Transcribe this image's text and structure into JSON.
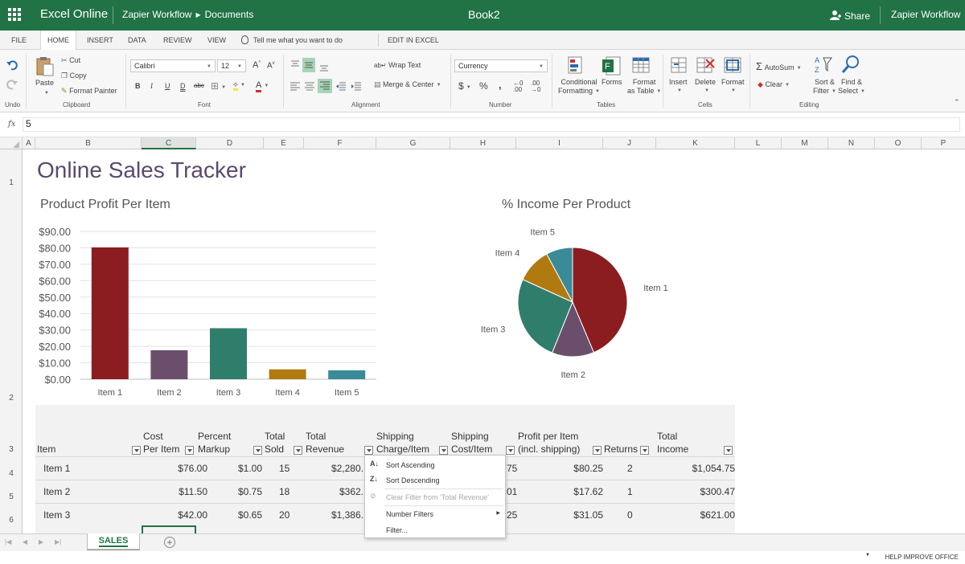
{
  "topbar": {
    "app_name": "Excel Online",
    "crumb_workspace": "Zapier Workflow",
    "crumb_folder": "Documents",
    "doc_title": "Book2",
    "share_label": "Share",
    "user_label": "Zapier Workflow"
  },
  "tabs": [
    "FILE",
    "HOME",
    "INSERT",
    "DATA",
    "REVIEW",
    "VIEW"
  ],
  "tell_me": "Tell me what you want to do",
  "edit_in_excel": "EDIT IN EXCEL",
  "ribbon": {
    "undo_label": "Undo",
    "clipboard": {
      "paste": "Paste",
      "cut": "Cut",
      "copy": "Copy",
      "format_painter": "Format Painter",
      "group": "Clipboard"
    },
    "font": {
      "name": "Calibri",
      "size": "12",
      "group": "Font"
    },
    "alignment": {
      "wrap": "Wrap Text",
      "merge": "Merge & Center",
      "group": "Alignment"
    },
    "number": {
      "format": "Currency",
      "currency_symbol": "$",
      "percent": "%",
      "comma": ",",
      "group": "Number"
    },
    "tables": {
      "cond1": "Conditional",
      "cond2": "Formatting",
      "forms": "Forms",
      "fmt1": "Format",
      "fmt2": "as Table",
      "group": "Tables"
    },
    "cells": {
      "insert": "Insert",
      "delete": "Delete",
      "format": "Format",
      "group": "Cells"
    },
    "editing": {
      "autosum": "AutoSum",
      "clear": "Clear",
      "sort1": "Sort &",
      "sort2": "Filter",
      "find1": "Find &",
      "find2": "Select",
      "group": "Editing"
    }
  },
  "formula_bar": {
    "fx": "fx",
    "value": "5"
  },
  "columns": [
    "A",
    "B",
    "C",
    "D",
    "E",
    "F",
    "G",
    "H",
    "I",
    "J",
    "K",
    "L",
    "M",
    "N",
    "O",
    "P"
  ],
  "rows": [
    "1",
    "2",
    "3",
    "4",
    "5",
    "6"
  ],
  "sheet_title": "Online Sales Tracker",
  "chart_data": [
    {
      "type": "bar",
      "title": "Product Profit Per Item",
      "categories": [
        "Item 1",
        "Item 2",
        "Item 3",
        "Item 4",
        "Item 5"
      ],
      "values": [
        80.25,
        17.62,
        31.05,
        6.0,
        5.4
      ],
      "colors": [
        "#8b1c1f",
        "#6b4e6c",
        "#2f7d6b",
        "#b07a10",
        "#3a8a97"
      ],
      "ylim": [
        0,
        90
      ],
      "yticks": [
        "$0.00",
        "$10.00",
        "$20.00",
        "$30.00",
        "$40.00",
        "$50.00",
        "$60.00",
        "$70.00",
        "$80.00",
        "$90.00"
      ],
      "grid": true
    },
    {
      "type": "pie",
      "title": "% Income Per Product",
      "categories": [
        "Item 1",
        "Item 2",
        "Item 3",
        "Item 4",
        "Item 5"
      ],
      "values": [
        1054.75,
        300.47,
        621.0,
        250.0,
        190.0
      ],
      "colors": [
        "#8b1c1f",
        "#6b4e6c",
        "#2f7d6b",
        "#b07a10",
        "#3a8a97"
      ]
    }
  ],
  "table": {
    "headers": {
      "item": "Item",
      "cost1": "Cost",
      "cost2": "Per Item",
      "pct1": "Percent",
      "pct2": "Markup",
      "sold1": "Total",
      "sold2": "Sold",
      "rev1": "Total",
      "rev2": "Revenue",
      "ship1": "Shipping",
      "ship2": "Charge/Item",
      "shipc1": "Shipping",
      "shipc2": "Cost/Item",
      "profit1": "Profit per Item",
      "profit2": "(incl. shipping)",
      "returns": "Returns",
      "income1": "Total",
      "income2": "Income"
    },
    "rows": [
      {
        "item": "Item 1",
        "cost": "$76.00",
        "markup": "$1.00",
        "sold": "15",
        "revenue": "$2,280.",
        "shipcost": "75",
        "profit": "$80.25",
        "returns": "2",
        "income": "$1,054.75"
      },
      {
        "item": "Item 2",
        "cost": "$11.50",
        "markup": "$0.75",
        "sold": "18",
        "revenue": "$362.",
        "shipcost": "01",
        "profit": "$17.62",
        "returns": "1",
        "income": "$300.47"
      },
      {
        "item": "Item 3",
        "cost": "$42.00",
        "markup": "$0.65",
        "sold": "20",
        "revenue": "$1,386.",
        "shipcost": "25",
        "profit": "$31.05",
        "returns": "0",
        "income": "$621.00"
      }
    ]
  },
  "filter_menu": {
    "sort_asc": "Sort Ascending",
    "sort_desc": "Sort Descending",
    "clear_filter": "Clear Filter from 'Total Revenue'",
    "number_filters": "Number Filters",
    "filter": "Filter..."
  },
  "sheet_tab": "SALES",
  "add_sheet": "+",
  "status": {
    "help": "HELP IMPROVE OFFICE"
  }
}
